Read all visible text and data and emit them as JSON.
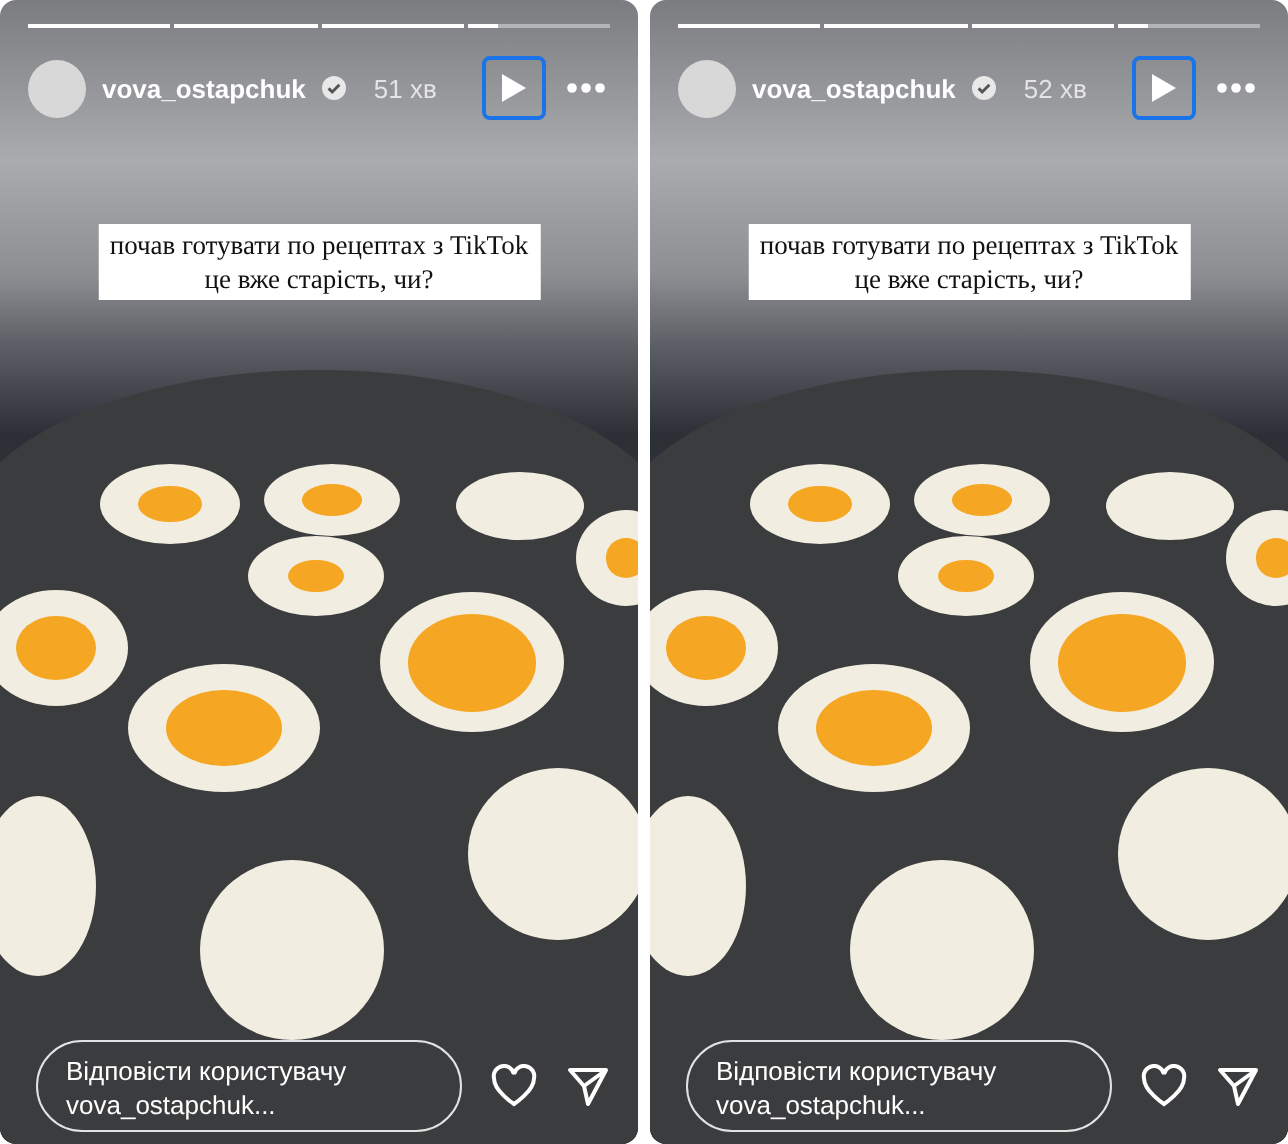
{
  "stories": [
    {
      "progress": [
        {
          "level": 1
        },
        {
          "level": 1
        },
        {
          "level": 1
        },
        {
          "level": 0.22
        }
      ],
      "username": "vova_ostapchuk",
      "time": "51 хв",
      "play_focused": true,
      "caption": [
        "почав готувати по рецептах з TikTok",
        "це вже старість, чи?"
      ],
      "reply_placeholder": "Відповісти користувачу vova_ostapchuk..."
    },
    {
      "progress": [
        {
          "level": 1
        },
        {
          "level": 1
        },
        {
          "level": 1
        },
        {
          "level": 0.22
        }
      ],
      "username": "vova_ostapchuk",
      "time": "52 хв",
      "play_focused": true,
      "caption": [
        "почав готувати по рецептах з TikTok",
        "це вже старість, чи?"
      ],
      "reply_placeholder": "Відповісти користувачу vova_ostapchuk..."
    }
  ]
}
